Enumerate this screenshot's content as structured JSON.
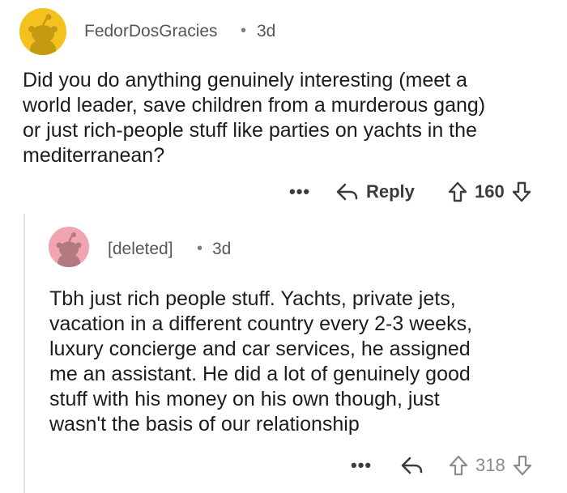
{
  "comments": [
    {
      "username": "FedorDosGracies",
      "separator": "•",
      "age": "3d",
      "body_lines": [
        "Did you do anything genuinely interesting (meet a",
        "world leader, save children from a murderous gang)",
        "or just rich-people stuff like parties on yachts in the",
        "mediterranean?"
      ],
      "more_label": "•••",
      "reply_label": "Reply",
      "score": "160",
      "avatar_color": "#f4c21f",
      "avatar_icon": "snoo-avatar-icon"
    },
    {
      "username": "[deleted]",
      "separator": "•",
      "age": "3d",
      "body_lines": [
        "Tbh just rich people stuff. Yachts, private jets,",
        "vacation in a different country every 2-3 weeks,",
        "luxury concierge and car services, he assigned",
        "me an assistant. He did a lot of genuinely good",
        "stuff with his money on his own though, just",
        "wasn't the basis of our relationship"
      ],
      "more_label": "•••",
      "score": "318",
      "avatar_color": "#f1a5b0",
      "avatar_icon": "snoo-avatar-icon"
    }
  ],
  "colors": {
    "text_primary": "#1c1c1c",
    "text_meta": "#555657",
    "action_text": "#3c3c3c",
    "thread_line": "#e5e5e5"
  }
}
